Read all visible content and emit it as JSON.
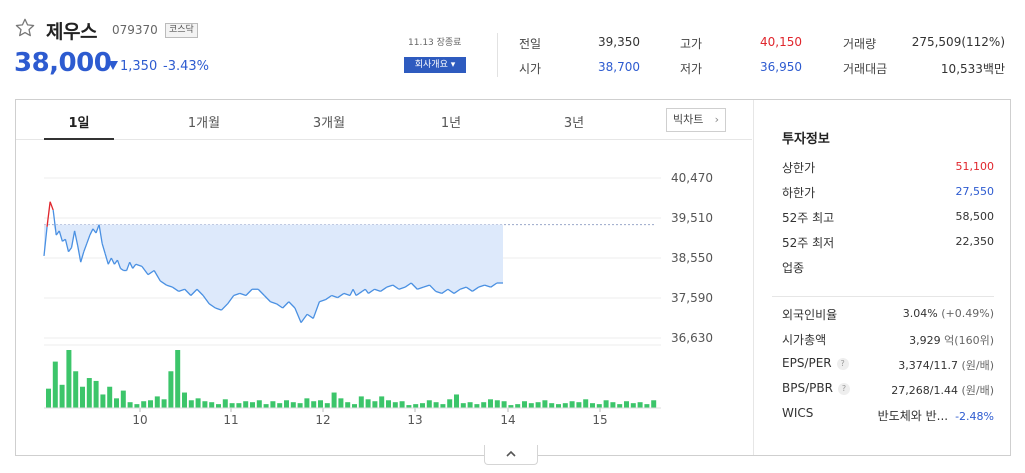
{
  "header": {
    "name": "제우스",
    "code": "079370",
    "market": "코스닥",
    "price": "38,000",
    "change": "1,350",
    "change_pct": "-3.43%",
    "close_time": "11.13 장종료",
    "company_btn": "회사개요 ▾",
    "accent": "#2d5bd0",
    "down_color": "#2d5bd0",
    "up_color": "#e0262d"
  },
  "quotes": {
    "prev_close": {
      "label": "전일",
      "value": "39,350"
    },
    "open": {
      "label": "시가",
      "value": "38,700"
    },
    "high": {
      "label": "고가",
      "value": "40,150"
    },
    "low": {
      "label": "저가",
      "value": "36,950"
    },
    "volume": {
      "label": "거래량",
      "value": "275,509(112%)"
    },
    "amount": {
      "label": "거래대금",
      "value": "10,533백만"
    }
  },
  "tabs": [
    "1일",
    "1개월",
    "3개월",
    "1년",
    "3년"
  ],
  "bigchart_label": "빅차트",
  "panel": {
    "title": "투자정보",
    "upper_limit": {
      "label": "상한가",
      "value": "51,100"
    },
    "lower_limit": {
      "label": "하한가",
      "value": "27,550"
    },
    "high52": {
      "label": "52주 최고",
      "value": "58,500"
    },
    "low52": {
      "label": "52주 최저",
      "value": "22,350"
    },
    "industry": {
      "label": "업종"
    },
    "foreign": {
      "label": "외국인비율",
      "value": "3.04%",
      "sub": "(+0.49%)"
    },
    "mktcap": {
      "label": "시가총액",
      "value": "3,929",
      "sub": "억(160위)"
    },
    "eps": {
      "label": "EPS/PER",
      "value": "3,374/11.7",
      "sub": "(원/배)"
    },
    "bps": {
      "label": "BPS/PBR",
      "value": "27,268/1.44",
      "sub": "(원/배)"
    },
    "wics": {
      "label": "WICS",
      "value": "반도체와 반...",
      "pct": "-2.48%"
    }
  },
  "chart_data": {
    "type": "line",
    "y_ticks": [
      "40,470",
      "39,510",
      "38,550",
      "37,590",
      "36,630"
    ],
    "ylim": [
      36630,
      40470
    ],
    "x_ticks": [
      "10",
      "11",
      "12",
      "13",
      "14",
      "15"
    ],
    "x_tick_pos": [
      9.5,
      11,
      12.5,
      14,
      15.5,
      17
    ],
    "xlim": [
      9,
      19
    ],
    "prev_close": 39350,
    "x": [
      9.0,
      9.05,
      9.1,
      9.15,
      9.2,
      9.25,
      9.3,
      9.35,
      9.4,
      9.45,
      9.5,
      9.55,
      9.6,
      9.65,
      9.7,
      9.75,
      9.8,
      9.85,
      9.9,
      9.95,
      10.0,
      10.05,
      10.1,
      10.15,
      10.2,
      10.25,
      10.3,
      10.35,
      10.4,
      10.45,
      10.5,
      10.6,
      10.7,
      10.8,
      10.9,
      11.0,
      11.1,
      11.2,
      11.3,
      11.4,
      11.5,
      11.6,
      11.7,
      11.8,
      11.9,
      12.0,
      12.1,
      12.2,
      12.3,
      12.4,
      12.5,
      12.6,
      12.7,
      12.8,
      12.9,
      13.0,
      13.1,
      13.2,
      13.3,
      13.4,
      13.5,
      13.6,
      13.7,
      13.8,
      13.9,
      14.0,
      14.05,
      14.1,
      14.15,
      14.2,
      14.25,
      14.3,
      14.4,
      14.5,
      14.6,
      14.7,
      14.8,
      14.9,
      15.0,
      15.1,
      15.2,
      15.3,
      15.4,
      15.5,
      15.6,
      15.7,
      15.8,
      15.9,
      16.0,
      16.1,
      16.2,
      16.3,
      16.4,
      16.5,
      16.6,
      16.7,
      16.8,
      16.9,
      17.0,
      17.1,
      17.2,
      17.3,
      17.4,
      17.5,
      17.6,
      17.7,
      17.8,
      17.9,
      18.0
    ],
    "prices": [
      38600,
      39300,
      39900,
      39700,
      39100,
      39200,
      38950,
      39000,
      38700,
      38800,
      39200,
      38850,
      38450,
      38700,
      38900,
      39100,
      39250,
      39150,
      39350,
      38900,
      38650,
      38400,
      38550,
      38400,
      38500,
      38300,
      38250,
      38250,
      38450,
      38300,
      38400,
      38350,
      38150,
      38250,
      38000,
      37900,
      37850,
      37750,
      37800,
      37650,
      37800,
      37650,
      37450,
      37350,
      37300,
      37450,
      37650,
      37700,
      37650,
      37800,
      37800,
      37650,
      37500,
      37450,
      37350,
      37500,
      37350,
      37000,
      37200,
      37100,
      37500,
      37550,
      37650,
      37600,
      37700,
      37650,
      37800,
      37650,
      37700,
      37750,
      37800,
      37700,
      37800,
      37750,
      37850,
      37900,
      37800,
      37850,
      37950,
      37800,
      37850,
      37900,
      37750,
      37700,
      37800,
      37700,
      37800,
      37850,
      37750,
      37850,
      37900,
      37850,
      37950,
      37950
    ],
    "volume": [
      20,
      48,
      24,
      60,
      38,
      22,
      31,
      28,
      14,
      22,
      10,
      18,
      6,
      4,
      7,
      8,
      12,
      9,
      38,
      60,
      16,
      8,
      10,
      7,
      6,
      4,
      9,
      5,
      5,
      7,
      6,
      8,
      4,
      7,
      5,
      8,
      6,
      5,
      10,
      7,
      8,
      5,
      16,
      10,
      6,
      4,
      12,
      9,
      7,
      12,
      8,
      6,
      7,
      3,
      4,
      5,
      8,
      6,
      4,
      9,
      14,
      5,
      6,
      4,
      6,
      9,
      8,
      7,
      3,
      4,
      7,
      5,
      6,
      8,
      5,
      4,
      5,
      7,
      6,
      9,
      5,
      4,
      8,
      6,
      4,
      7,
      5,
      6,
      4,
      8,
      10,
      5,
      4,
      6,
      12,
      16
    ],
    "volume_x_start": 9.0,
    "volume_x_step": 0.085
  },
  "collapse_label": "⌃"
}
